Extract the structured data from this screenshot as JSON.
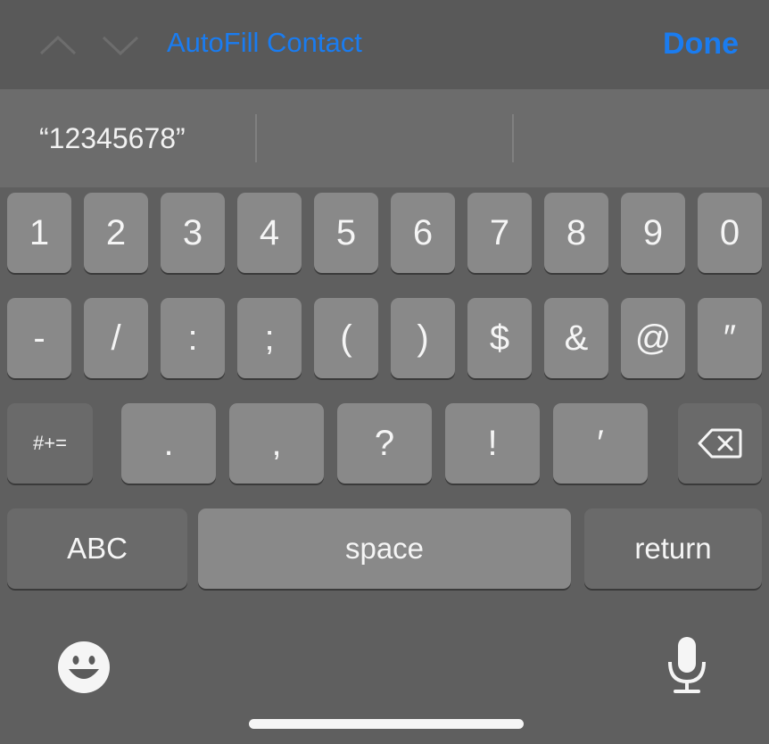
{
  "toolbar": {
    "autofill_label": "AutoFill Contact",
    "done_label": "Done",
    "prev_icon": "chevron-up-icon",
    "next_icon": "chevron-down-icon"
  },
  "predictions": [
    "“12345678”",
    "",
    ""
  ],
  "keys": {
    "row1": [
      "1",
      "2",
      "3",
      "4",
      "5",
      "6",
      "7",
      "8",
      "9",
      "0"
    ],
    "row2": [
      "-",
      "/",
      ":",
      ";",
      "(",
      ")",
      "$",
      "&",
      "@",
      "″"
    ],
    "row3": [
      "#+=",
      ".",
      ",",
      "?",
      "!",
      "′",
      "⌫"
    ],
    "abc": "ABC",
    "space": "space",
    "return": "return"
  },
  "colors": {
    "accent": "#1a7cf0",
    "key": "#898989",
    "key_dark": "#6a6a6a",
    "keyboard_bg": "#5f5f5f"
  },
  "bottom": {
    "emoji_icon": "emoji-icon",
    "mic_icon": "microphone-icon"
  }
}
